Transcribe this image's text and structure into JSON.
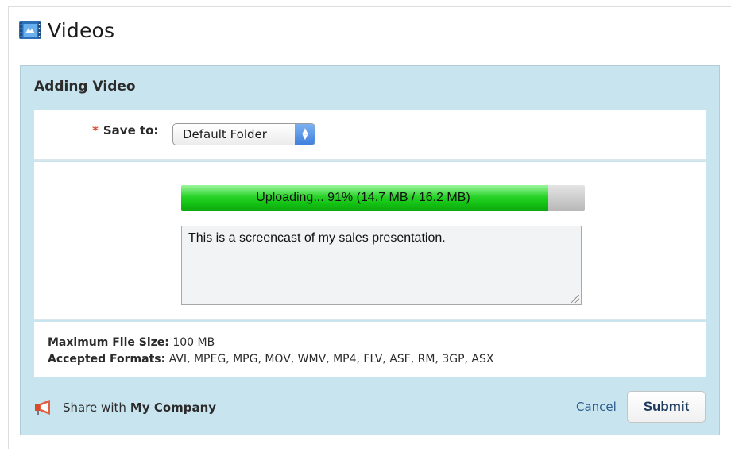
{
  "page": {
    "title": "Videos",
    "title_icon": "video-icon"
  },
  "dialog": {
    "title": "Adding Video",
    "save_to": {
      "required_mark": "*",
      "label": "Save to:",
      "selected_option": "Default Folder"
    },
    "upload": {
      "status_text": "Uploading... 91% (14.7 MB / 16.2 MB)",
      "progress_percent": 91,
      "uploaded": "14.7 MB",
      "total": "16.2 MB",
      "progress_color": "#1fcc1f"
    },
    "description": {
      "value": "This is a screencast of my sales presentation."
    },
    "limits": {
      "max_size_label": "Maximum File Size:",
      "max_size_value": "100 MB",
      "formats_label": "Accepted Formats:",
      "formats_value": "AVI, MPEG, MPG, MOV, WMV, MP4, FLV, ASF, RM, 3GP, ASX"
    },
    "footer": {
      "share_icon": "megaphone-icon",
      "share_prefix": "Share with",
      "share_target": "My Company",
      "cancel_label": "Cancel",
      "submit_label": "Submit"
    }
  },
  "colors": {
    "dialog_background": "#c8e4ef",
    "link": "#2f5f8f",
    "required": "#e0462b"
  }
}
